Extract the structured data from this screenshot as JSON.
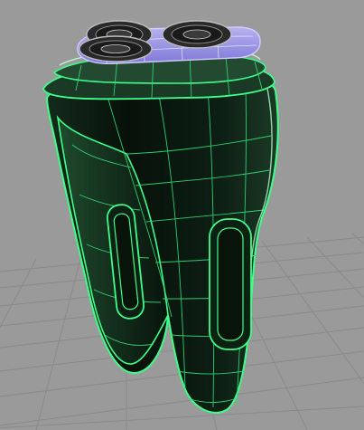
{
  "viewport": {
    "background": "#9a9a9a",
    "grid_color": "#8c8c8c",
    "view": "perspective"
  },
  "model": {
    "object": "electric shaver",
    "body_color": "#0b1a10",
    "wireframe_color": "#3dff8a",
    "highlight_color": "#b8ffd2",
    "head_color": "#9a94e8",
    "head_wire_color": "#d0ccff",
    "blade_ring_color": "#2a2a2a",
    "blade_ring_highlight": "#bdbdbd",
    "blade_ring_count": 3,
    "side_slot_count": 2
  }
}
